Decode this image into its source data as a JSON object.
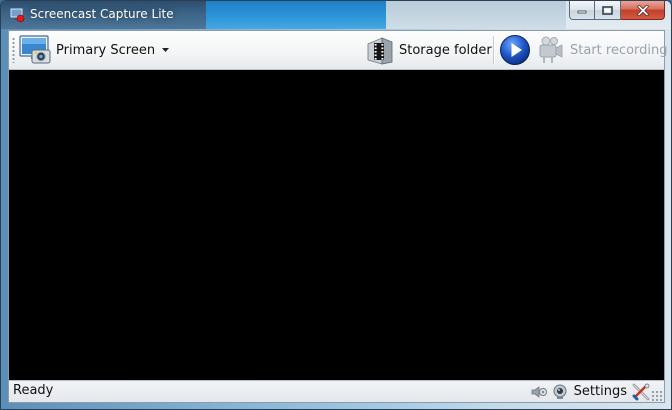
{
  "window": {
    "title": "Screencast Capture Lite"
  },
  "toolbar": {
    "source_label": "Primary Screen",
    "storage_label": "Storage folder",
    "record_label": "Start recording"
  },
  "statusbar": {
    "status_text": "Ready",
    "settings_label": "Settings"
  },
  "icons": {
    "app": "screencast-app-icon",
    "source": "screen-camera-icon",
    "dropdown": "caret-down-icon",
    "storage": "film-folder-icon",
    "play": "play-icon",
    "record": "camcorder-icon",
    "audio": "speaker-icon",
    "webcam": "webcam-icon",
    "settings": "tools-icon"
  },
  "colors": {
    "play_blue": "#1e57c8",
    "video_background": "#000000",
    "close_red": "#c4402a"
  }
}
